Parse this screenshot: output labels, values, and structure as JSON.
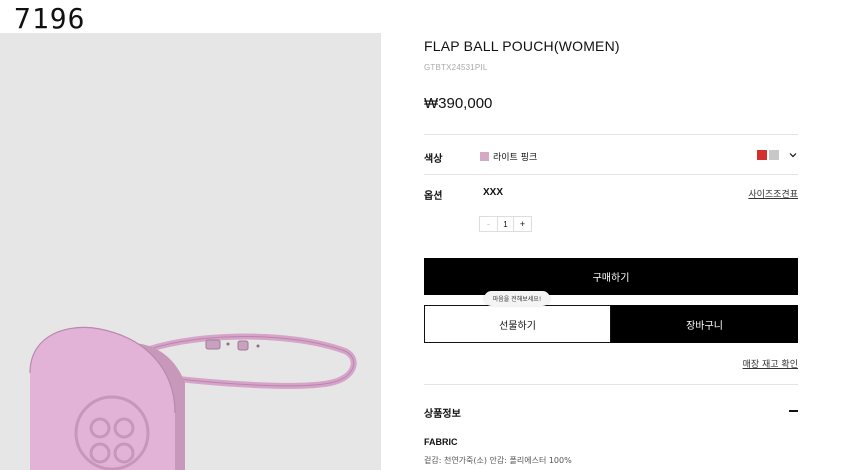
{
  "page_id": "7196",
  "product": {
    "title": "FLAP BALL POUCH(WOMEN)",
    "code": "GTBTX24531PIL",
    "price": "₩390,000"
  },
  "color_row": {
    "label": "색상",
    "value": "라이트 핑크",
    "selected_color": "#d4a9c6",
    "swatches": [
      "#d32f2f",
      "#c8c8c8"
    ]
  },
  "option_row": {
    "label": "옵션",
    "value": "XXX",
    "size_link": "사이즈조견표"
  },
  "quantity": {
    "minus": "-",
    "value": "1",
    "plus": "+"
  },
  "buttons": {
    "buy": "구매하기",
    "gift_tooltip": "마음을 전해보세요!",
    "gift": "선물하기",
    "cart": "장바구니"
  },
  "stock_link": "매장 재고 확인",
  "details": {
    "section_title": "상품정보",
    "fabric_title": "FABRIC",
    "fabric_text": "겉감: 천연가죽(소) 안감: 폴리에스터 100%"
  },
  "image": {
    "background": "#e6e6e6",
    "product_color": "#e2b3d6"
  }
}
